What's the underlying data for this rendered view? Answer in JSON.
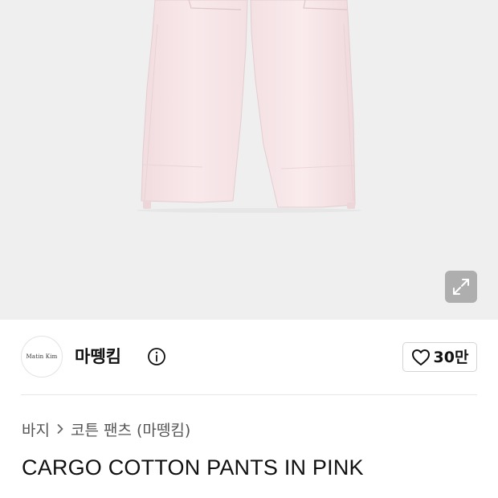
{
  "hero": {
    "expand_icon": "expand-arrows-icon"
  },
  "brand": {
    "logo_text": "Matin  Kim",
    "name": "마뗑킴",
    "info_icon": "info-circle-icon"
  },
  "like": {
    "icon": "heart-outline-icon",
    "count": "30만"
  },
  "breadcrumb": {
    "items": [
      "바지",
      "코튼 팬츠 (마뗑킴)"
    ],
    "separator_icon": "chevron-right-icon"
  },
  "product": {
    "title": "CARGO COTTON PANTS IN PINK"
  },
  "colors": {
    "hero_bg": "#efefef",
    "product": "#f7e4e6",
    "divider": "#e6e6e6"
  }
}
